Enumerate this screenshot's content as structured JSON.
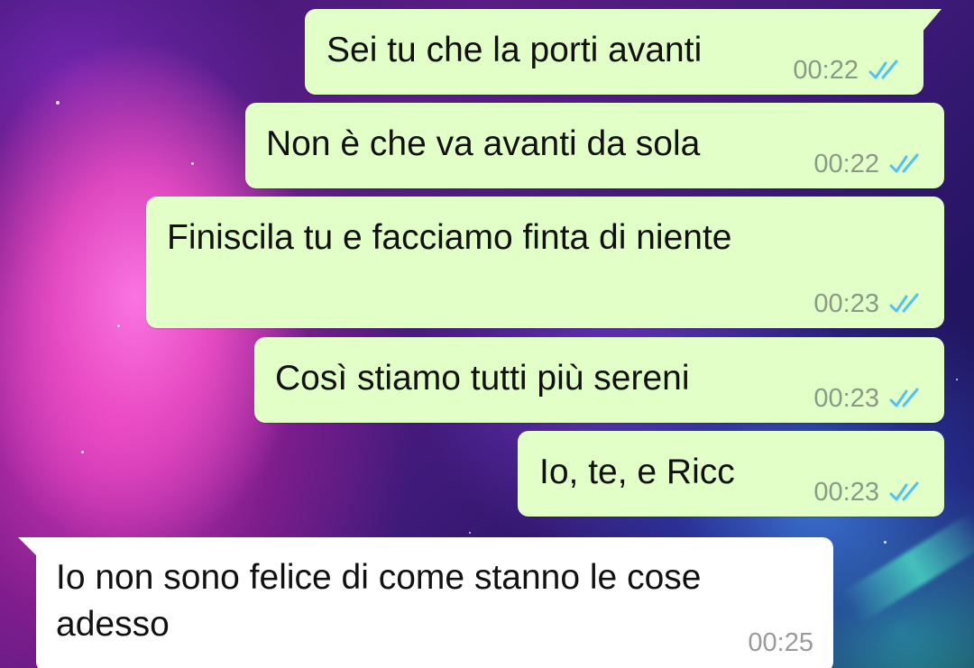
{
  "colors": {
    "outgoing_bubble": "#e2ffc7",
    "incoming_bubble": "#ffffff",
    "read_ticks": "#4fc3f7",
    "timestamp": "#8a9a86"
  },
  "messages": [
    {
      "direction": "outgoing",
      "text": "Sei tu che la porti avanti",
      "time": "00:22",
      "status_icon": "double-check-read-icon"
    },
    {
      "direction": "outgoing",
      "text": "Non è che va avanti da sola",
      "time": "00:22",
      "status_icon": "double-check-read-icon"
    },
    {
      "direction": "outgoing",
      "text": "Finiscila tu e facciamo finta di niente",
      "time": "00:23",
      "status_icon": "double-check-read-icon"
    },
    {
      "direction": "outgoing",
      "text": "Così stiamo tutti più sereni",
      "time": "00:23",
      "status_icon": "double-check-read-icon"
    },
    {
      "direction": "outgoing",
      "text": "Io, te, e Ricc",
      "time": "00:23",
      "status_icon": "double-check-read-icon"
    },
    {
      "direction": "incoming",
      "text_line1": "Io non sono felice di come stanno le cose",
      "text_line2": "adesso",
      "time": "00:25"
    }
  ]
}
